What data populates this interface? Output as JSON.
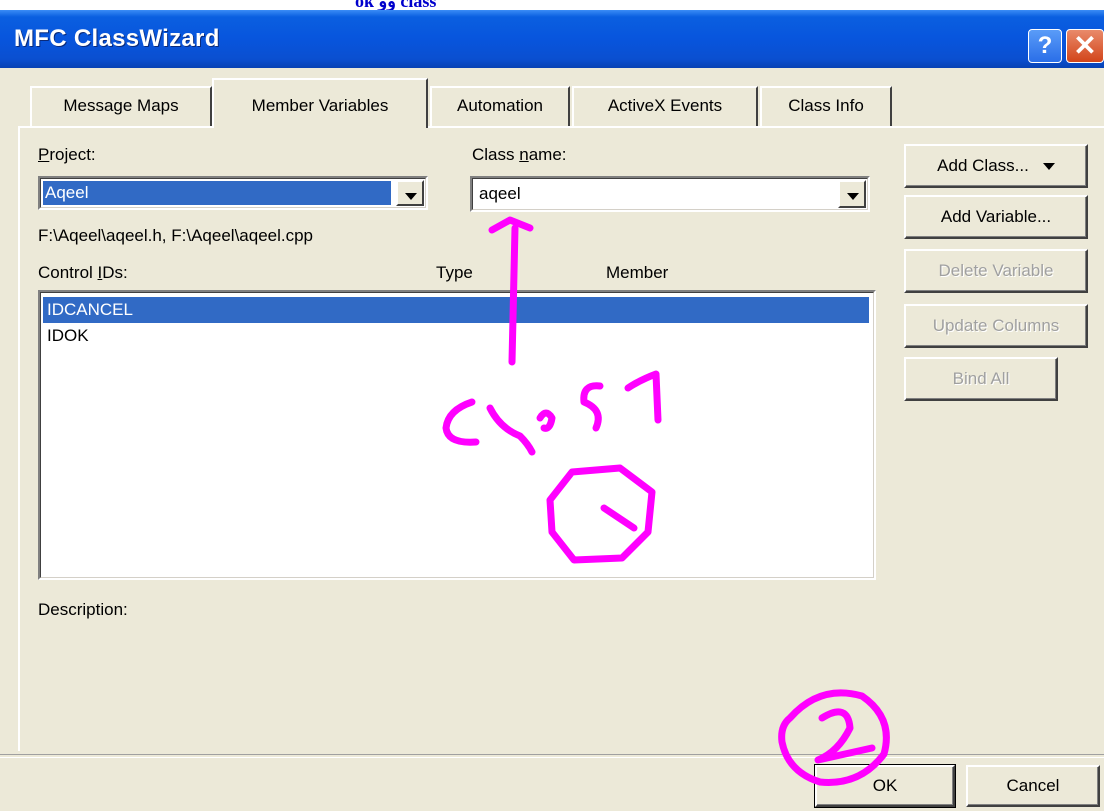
{
  "top_strip_text": "ok وو class",
  "window": {
    "title": "MFC ClassWizard",
    "help_label": "?",
    "close_label": "✕"
  },
  "tabs": [
    {
      "label": "Message Maps",
      "active": false
    },
    {
      "label": "Member Variables",
      "active": true
    },
    {
      "label": "Automation",
      "active": false
    },
    {
      "label": "ActiveX Events",
      "active": false
    },
    {
      "label": "Class Info",
      "active": false
    }
  ],
  "project": {
    "label_u": "P",
    "label_rest": "roject:",
    "value": "Aqeel"
  },
  "class_name": {
    "label_pre": "Class ",
    "label_u": "n",
    "label_rest": "ame:",
    "value": "aqeel"
  },
  "file_path": "F:\\Aqeel\\aqeel.h, F:\\Aqeel\\aqeel.cpp",
  "control_ids": {
    "label_pre": "Control ",
    "label_u": "I",
    "label_rest": "Ds:",
    "col_type": "Type",
    "col_member": "Member",
    "rows": [
      "IDCANCEL",
      "IDOK"
    ],
    "selected_index": 0
  },
  "description_label": "Description:",
  "side_buttons": {
    "add_class": "Add Class...",
    "add_variable": "Add Variable...",
    "delete_variable": "Delete Variable",
    "update_columns": "Update Columns",
    "bind_all": "Bind All"
  },
  "footer": {
    "ok": "OK",
    "cancel": "Cancel"
  },
  "annotation": {
    "handwriting": "Class",
    "marker_1": "1",
    "marker_2": "2",
    "color": "#ff00ff"
  },
  "colors": {
    "titlebar": "#0855dd",
    "selection": "#316ac5",
    "dialog_bg": "#ece9d8"
  }
}
